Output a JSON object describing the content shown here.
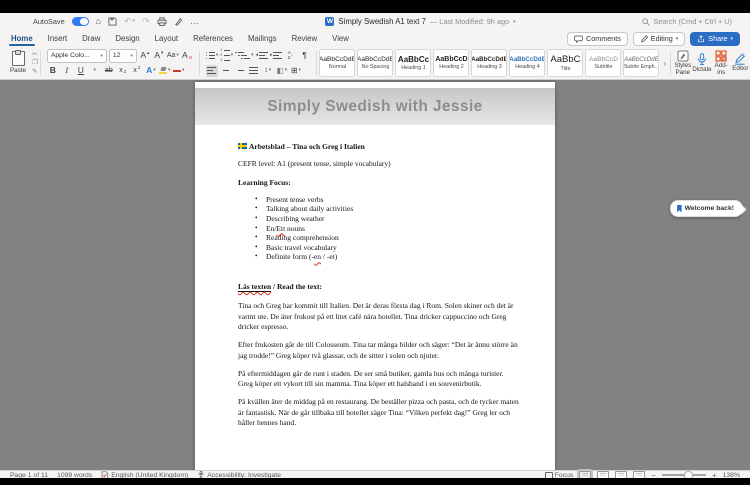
{
  "titlebar": {
    "autosave_label": "AutoSave",
    "doc_icon_letter": "W",
    "document_title": "Simply Swedish A1 text 7",
    "modified_label": "— Last Modified: 9h ago",
    "search_label": "Search (Cmd + Ctrl + U)"
  },
  "menu_tabs": {
    "items": [
      "Home",
      "Insert",
      "Draw",
      "Design",
      "Layout",
      "References",
      "Mailings",
      "Review",
      "View"
    ],
    "active": "Home"
  },
  "actions": {
    "comments": "Comments",
    "editing": "Editing",
    "share": "Share"
  },
  "ribbon": {
    "paste_label": "Paste",
    "font": {
      "name": "Apple Colo...",
      "size": "12"
    },
    "glyphs": {
      "home": "⌂",
      "undo": "↶",
      "redo": "↷",
      "ellipsis": "…",
      "bold": "B",
      "italic": "I",
      "underline": "U",
      "strikethrough": "ab",
      "subscript_x": "x",
      "superscript_x": "x",
      "sub_digit": "2",
      "sup_digit": "2",
      "grow_a": "A",
      "shrink_a": "A",
      "grow_mark": "▴",
      "shrink_mark": "▾",
      "change_case": "Aa",
      "clear_format": "A",
      "text_effects": "A",
      "pilcrow": "¶",
      "sort_a": "A",
      "sort_z": "Z",
      "sort_arrow": "↓",
      "line_spacing": "↕",
      "shading": "◧",
      "borders": "⊞",
      "indent_out": "◂",
      "indent_in": "▸",
      "chevron_more": "›",
      "caret": "▾"
    },
    "styles_gallery": [
      {
        "p": "AaBbCcDdE",
        "l": "Normal"
      },
      {
        "p": "AaBbCcDdE",
        "l": "No Spacing"
      },
      {
        "p": "AaBbCc",
        "l": "Heading 1"
      },
      {
        "p": "AaBbCcD",
        "l": "Heading 2"
      },
      {
        "p": "AaBbCcDdE",
        "l": "Heading 3"
      },
      {
        "p": "AaBbCcDdE",
        "l": "Heading 4"
      },
      {
        "p": "AaBbC",
        "l": "Title"
      },
      {
        "p": "AaBbCcD",
        "l": "Subtitle"
      },
      {
        "p": "AaBbCcDdE",
        "l": "Subtle Emph..."
      }
    ],
    "right_buttons": {
      "styles_pane_line1": "Styles",
      "styles_pane_line2": "Pane",
      "dictate": "Dictate",
      "addins": "Add-ins",
      "editor": "Editor"
    }
  },
  "document": {
    "header_title": "Simply Swedish with Jessie",
    "worksheet_title": "Arbetsblad – Tina och Greg i Italien",
    "cefr_line": "CEFR level: A1 (present tense, simple vocabulary)",
    "learning_focus_heading": "Learning Focus:",
    "bullets": {
      "item1": "Present tense verbs",
      "item2": "Talking about daily activities",
      "item3": "Describing weather",
      "item4_pre": "En/",
      "item4_err": "Ett",
      "item4_post": " nouns",
      "item5": "Reading comprehension",
      "item6": "Basic travel vocabulary",
      "item7_pre": "Definite form (-",
      "item7_err": "en",
      "item7_post": " / -et)"
    },
    "read_heading": {
      "sv": "Läs texten",
      "en": " / Read the text:"
    },
    "paragraphs": {
      "p1": "Tina och Greg har kommit till Italien. Det är deras första dag i Rom. Solen skiner och det är varmt ute. De äter frukost på ett litet café nära hotellet. Tina dricker cappuccino och Greg dricker espresso.",
      "p2": "Efter frukosten går de till Colosseum. Tina tar många bilder och säger: “Det är ännu större än jag trodde!” Greg köper två glassar, och de sitter i solen och njuter.",
      "p3": "På eftermiddagen går de runt i staden. De ser små butiker, gamla hus och många turister. Greg köper ett vykort till sin mamma. Tina köper ett halsband i en souvenirbutik.",
      "p4": "På kvällen äter de middag på en restaurang. De beställer pizza och pasta, och de tycker maten är fantastisk. När de går tillbaka till hotellet säger Tina: “Vilken perfekt dag!” Greg ler och håller hennes hand."
    }
  },
  "welcome_tooltip": {
    "label": "Welcome back!"
  },
  "statusbar": {
    "page_info": "Page 1 of 11",
    "word_count": "1099 words",
    "language": "English (United Kingdom)",
    "accessibility": "Accessibility: Investigate",
    "focus_label": "Focus",
    "zoom_minus": "−",
    "zoom_plus": "+",
    "zoom_level": "138%"
  }
}
